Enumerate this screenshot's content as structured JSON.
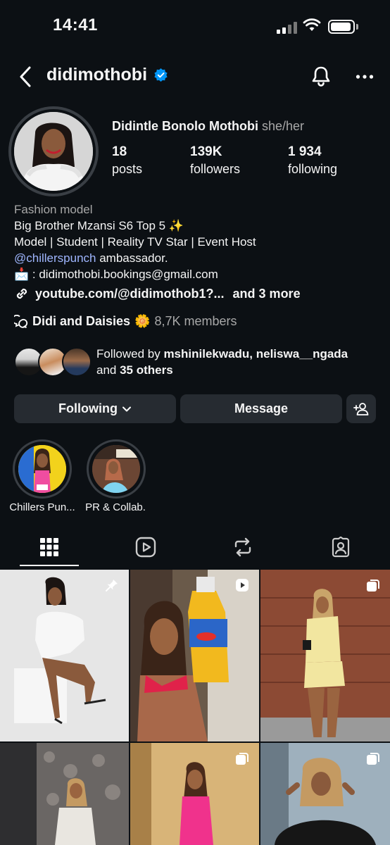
{
  "status": {
    "time": "14:41"
  },
  "header": {
    "username": "didimothobi"
  },
  "profile": {
    "full_name": "Didintle Bonolo Mothobi",
    "pronouns": "she/her",
    "stats": [
      {
        "value": "18",
        "label": "posts"
      },
      {
        "value": "139K",
        "label": "followers"
      },
      {
        "value": "1 934",
        "label": "following"
      }
    ]
  },
  "bio": {
    "category": "Fashion model",
    "line1": "Big Brother Mzansi S6 Top 5 ✨",
    "line2": "Model | Student | Reality TV Star | Event Host",
    "mention": "@chillerspunch",
    "line3_rest": " ambassador.",
    "email_icon": "📩",
    "line4": " : didimothobi.bookings@gmail.com",
    "link": "youtube.com/@didimothob1?...",
    "link_more": "and 3 more",
    "channel_name": "Didi and Daisies",
    "channel_emoji": "🌼",
    "channel_members": "8,7K members"
  },
  "followed_by": {
    "prefix": "Followed by ",
    "names": "mshinilekwadu, neliswa__ngada",
    "and": "and ",
    "others": "35 others"
  },
  "actions": {
    "following": "Following",
    "message": "Message"
  },
  "highlights": [
    {
      "label": "Chillers Pun..."
    },
    {
      "label": "PR & Collab."
    }
  ],
  "colors": {
    "background": "#0c1014",
    "button": "#262b31",
    "verified": "#0095f6",
    "mention": "#9fb6ff"
  }
}
